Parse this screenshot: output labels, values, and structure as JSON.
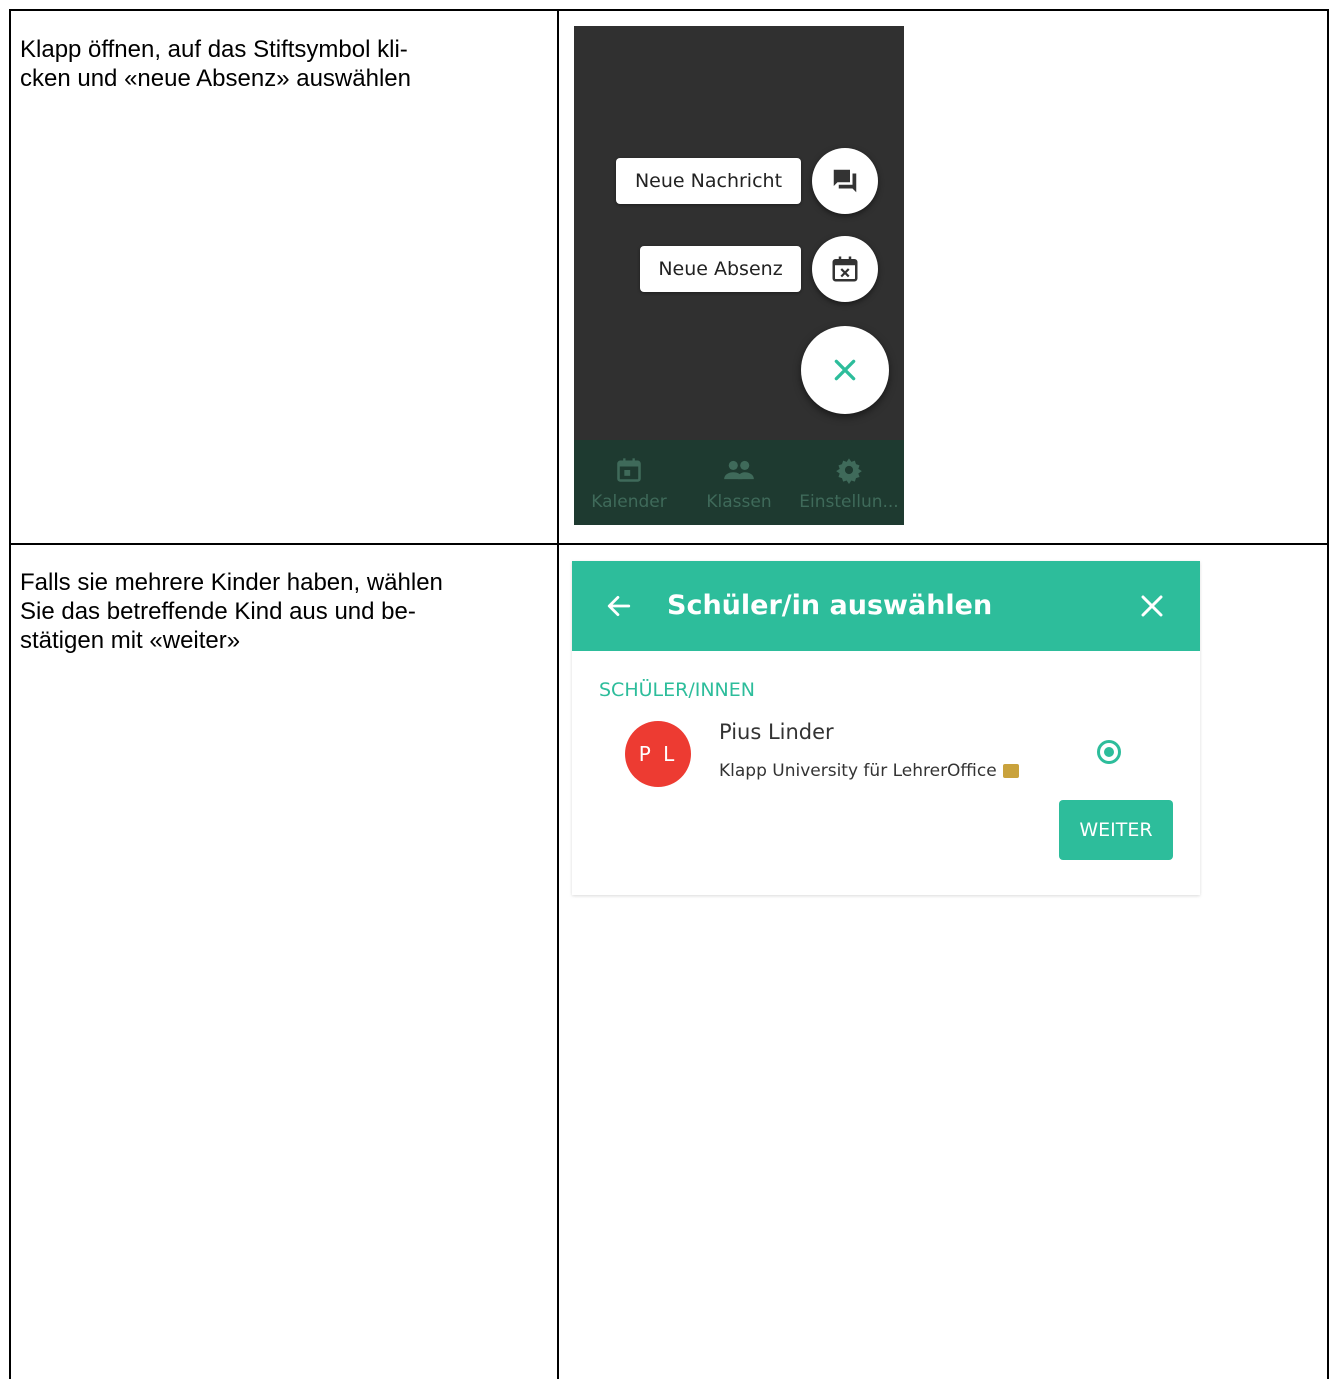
{
  "rows": [
    {
      "instruction": "Klapp öffnen, auf das Stiftsymbol kli-\ncken und «neue Absenz» auswählen"
    },
    {
      "instruction": "Falls sie mehrere Kinder haben, wählen\nSie das betreffende Kind aus und be-\nstätigen mit «weiter»"
    }
  ],
  "fab_menu": {
    "new_message_label": "Neue Nachricht",
    "new_absence_label": "Neue Absenz",
    "icons": {
      "message": "chat-icon",
      "absence": "calendar-x-icon",
      "close": "close-icon"
    }
  },
  "bottom_nav": {
    "items": [
      {
        "label": "Kalender",
        "icon": "calendar-icon"
      },
      {
        "label": "Klassen",
        "icon": "people-icon"
      },
      {
        "label": "Einstellun...",
        "icon": "gear-icon"
      }
    ]
  },
  "select_student": {
    "title": "Schüler/in auswählen",
    "section_title": "SCHÜLER/INNEN",
    "student": {
      "initials": "P L",
      "name": "Pius Linder",
      "school": "Klapp University für LehrerOffice"
    },
    "next_label": "WEITER",
    "colors": {
      "accent": "#2dbd9b",
      "avatar": "#ed3b32"
    }
  }
}
